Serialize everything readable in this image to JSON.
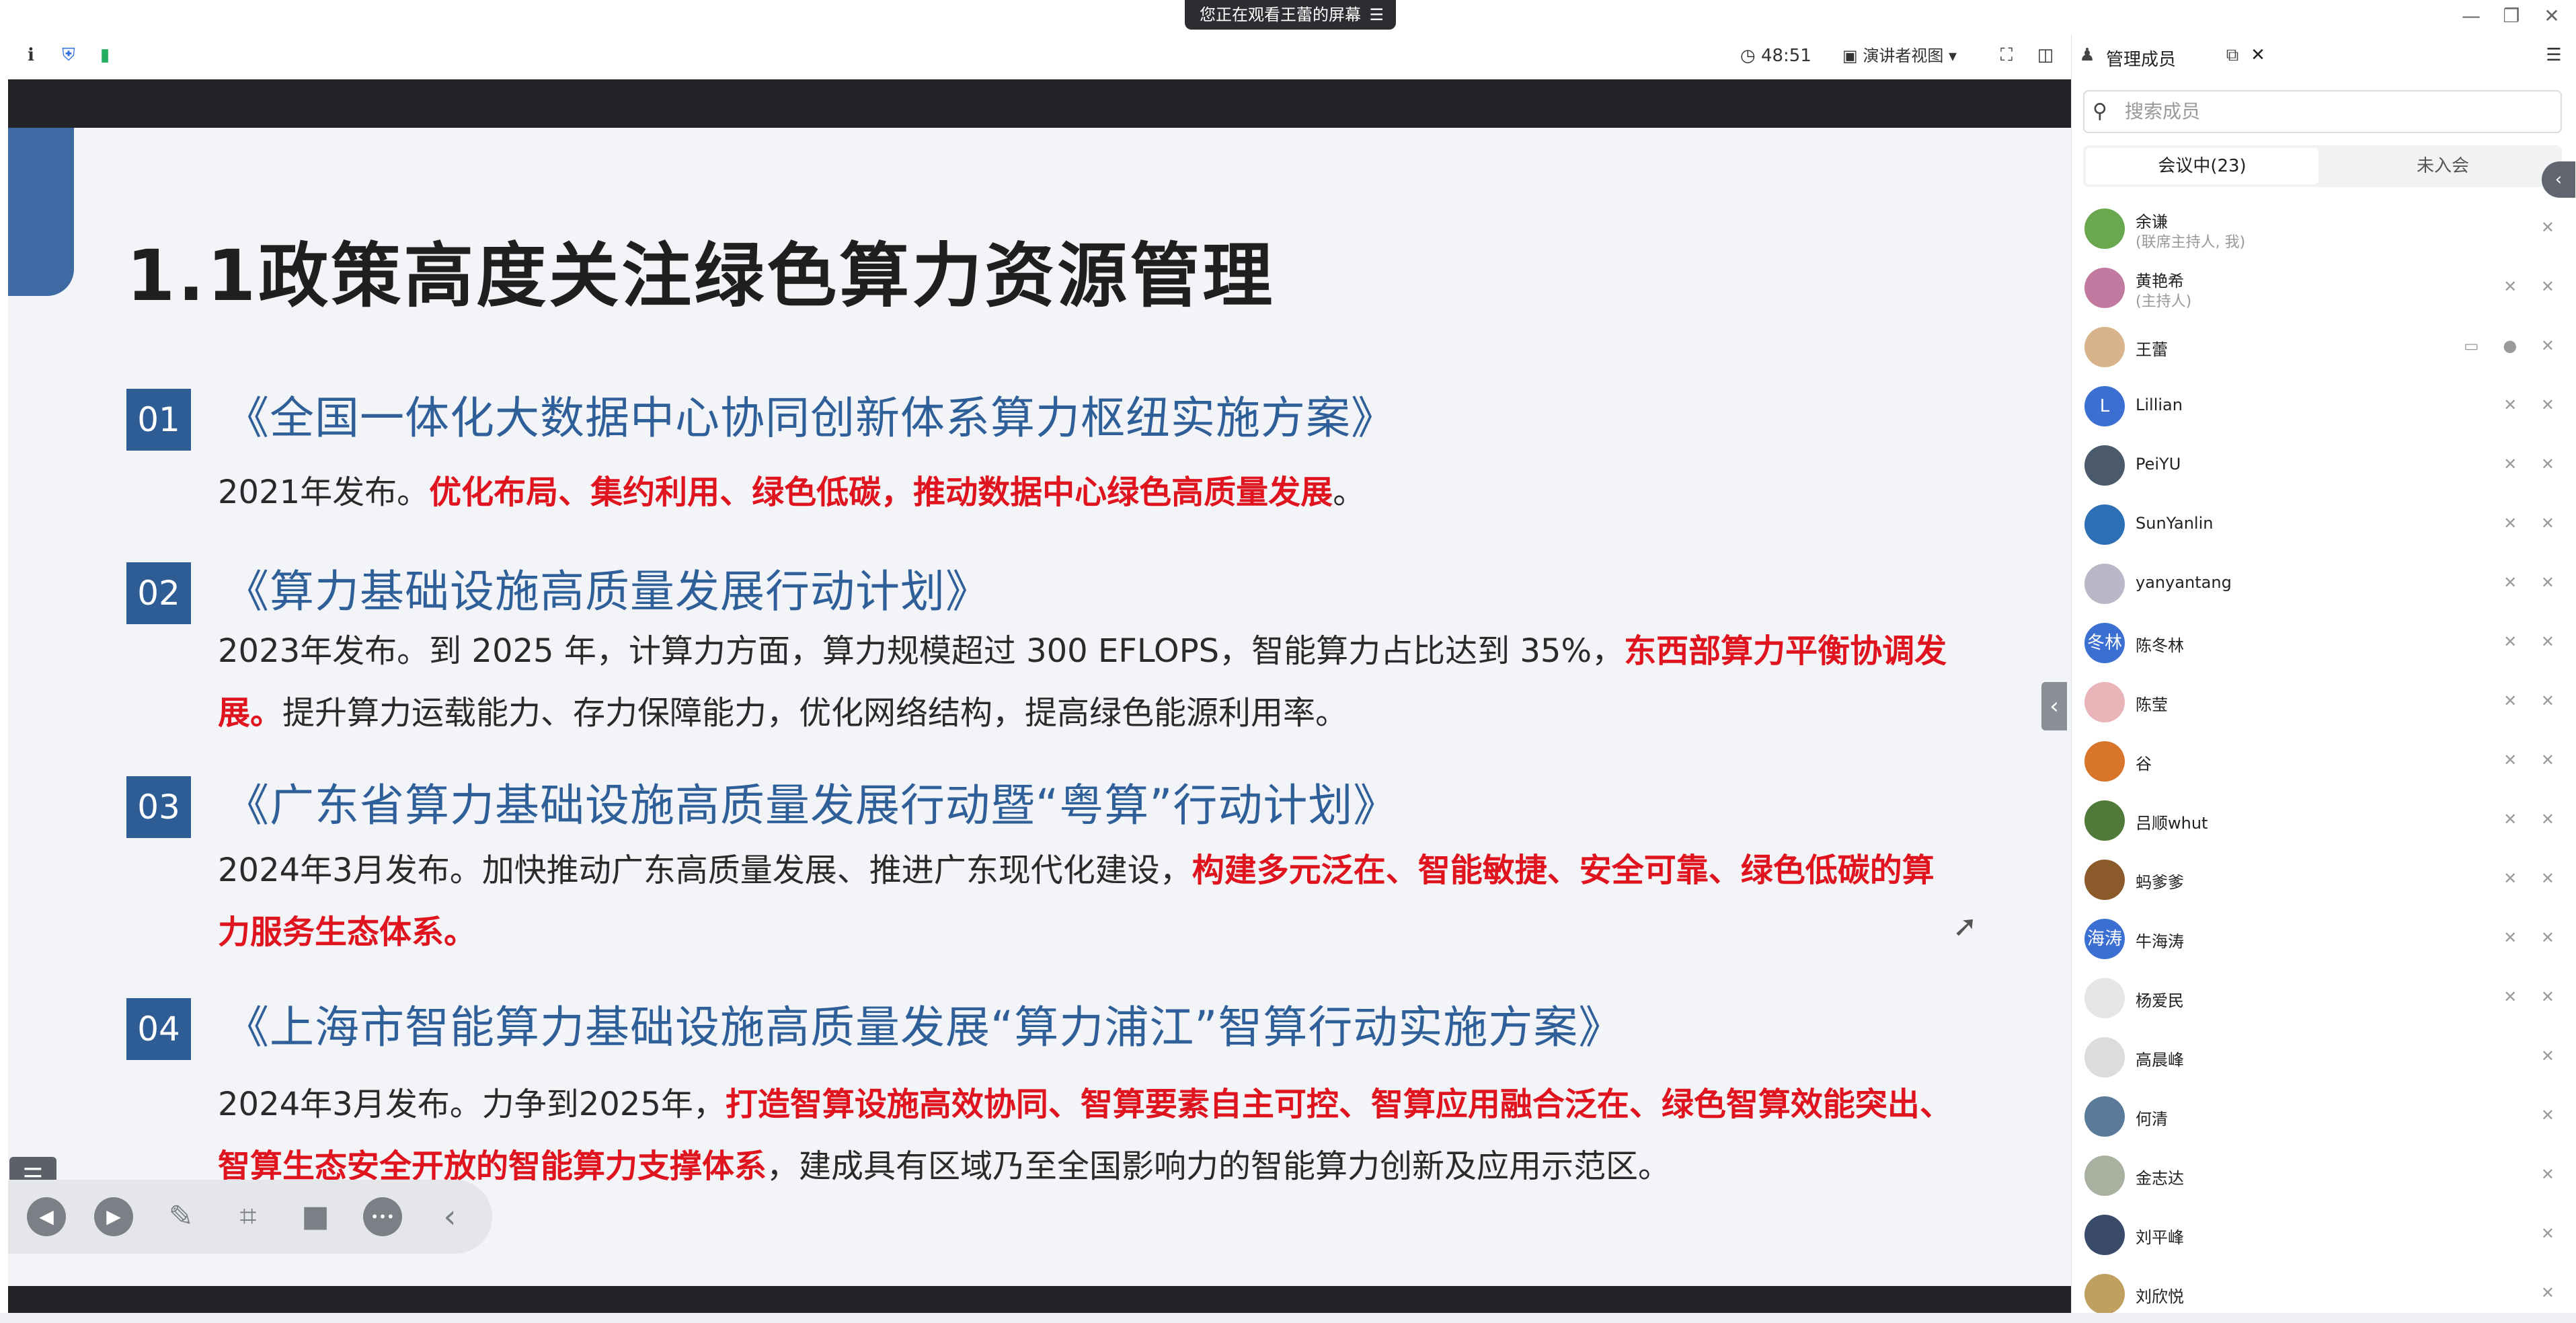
{
  "window": {
    "share_notice": "您正在观看王蕾的屏幕",
    "share_icon": "☰",
    "minimize": "—",
    "restore": "❐",
    "close": "✕"
  },
  "toolbar": {
    "info_icon": "ℹ",
    "shield_icon": "⛨",
    "signal_icon": "▮",
    "timer_icon": "◷",
    "timer": "48:51",
    "view_mode": "演讲者视图",
    "view_icon": "▣",
    "fullscreen_icon": "⛶",
    "layout_icon": "◫"
  },
  "slide": {
    "title": "1.1政策高度关注绿色算力资源管理",
    "items": [
      {
        "num": "01",
        "title": "《全国一体化大数据中心协同创新体系算力枢纽实施方案》",
        "body_plain": "2021年发布。",
        "body_red": "优化布局、集约利用、绿色低碳，推动数据中心绿色高质量发展",
        "body_tail": "。"
      },
      {
        "num": "02",
        "title": "《算力基础设施高质量发展行动计划》",
        "body_plain": "2023年发布。到 2025 年，计算力方面，算力规模超过 300 EFLOPS，智能算力占比达到 35%，",
        "body_red": "东西部算力平衡协调发展。",
        "body_tail": "提升算力运载能力、存力保障能力，优化网络结构，提高绿色能源利用率。"
      },
      {
        "num": "03",
        "title": "《广东省算力基础设施高质量发展行动暨“粤算”行动计划》",
        "body_plain": "2024年3月发布。加快推动广东高质量发展、推进广东现代化建设，",
        "body_red": "构建多元泛在、智能敏捷、安全可靠、绿色低碳的算力服务生态体系。",
        "body_tail": ""
      },
      {
        "num": "04",
        "title": "《上海市智能算力基础设施高质量发展“算力浦江”智算行动实施方案》",
        "body_plain": "2024年3月发布。力争到2025年，",
        "body_red": "打造智算设施高效协同、智算要素自主可控、智算应用融合泛在、绿色智算效能突出、智算生态安全开放的智能算力支撑体系",
        "body_tail": "，建成具有区域乃至全国影响力的智能算力创新及应用示范区。"
      }
    ]
  },
  "controls": {
    "list": "☰",
    "prev": "◀",
    "play": "▶",
    "pen": "✎",
    "screenshot": "⌗",
    "camera": "■",
    "more": "•••",
    "collapse": "‹",
    "side_collapse": "‹"
  },
  "panel": {
    "title": "管理成员",
    "popout_icon": "⧉",
    "close_icon": "✕",
    "menu_icon": "☰",
    "search_placeholder": "搜索成员",
    "search_icon": "⚲",
    "tab_in_meeting": "会议中(23)",
    "tab_not_joined": "未入会",
    "toggle_icon": "‹",
    "members": [
      {
        "name": "余谦",
        "sub": "(联席主持人, 我)",
        "avatar_text": "",
        "avatar_color": "#6aa84f",
        "icons": "✕"
      },
      {
        "name": "黄艳希",
        "sub": "(主持人)",
        "avatar_text": "",
        "avatar_color": "#c27ba0",
        "icons": "✕ ✕"
      },
      {
        "name": "王蕾",
        "sub": "",
        "avatar_text": "",
        "avatar_color": "#d9b38c",
        "icons": "▭ ● ✕"
      },
      {
        "name": "Lillian",
        "sub": "",
        "avatar_text": "L",
        "avatar_color": "#3b6fd1",
        "icons": "✕ ✕"
      },
      {
        "name": "PeiYU",
        "sub": "",
        "avatar_text": "",
        "avatar_color": "#4a5a6a",
        "icons": "✕ ✕"
      },
      {
        "name": "SunYanlin",
        "sub": "",
        "avatar_text": "",
        "avatar_color": "#2d6fb5",
        "icons": "✕ ✕"
      },
      {
        "name": "yanyantang",
        "sub": "",
        "avatar_text": "",
        "avatar_color": "#b8b8c8",
        "icons": "✕ ✕"
      },
      {
        "name": "陈冬林",
        "sub": "",
        "avatar_text": "冬林",
        "avatar_color": "#3b6fd1",
        "icons": "✕ ✕"
      },
      {
        "name": "陈莹",
        "sub": "",
        "avatar_text": "",
        "avatar_color": "#e8b4b8",
        "icons": "✕ ✕"
      },
      {
        "name": "谷",
        "sub": "",
        "avatar_text": "",
        "avatar_color": "#d9742b",
        "icons": "✕ ✕"
      },
      {
        "name": "吕顺whut",
        "sub": "",
        "avatar_text": "",
        "avatar_color": "#4f7a3a",
        "icons": "✕ ✕"
      },
      {
        "name": "蚂爹爹",
        "sub": "",
        "avatar_text": "",
        "avatar_color": "#8a5a2b",
        "icons": "✕ ✕"
      },
      {
        "name": "牛海涛",
        "sub": "",
        "avatar_text": "海涛",
        "avatar_color": "#3b6fd1",
        "icons": "✕ ✕"
      },
      {
        "name": "杨爱民",
        "sub": "",
        "avatar_text": "",
        "avatar_color": "#e6e6e6",
        "icons": "✕ ✕"
      },
      {
        "name": "高晨峰",
        "sub": "",
        "avatar_text": "",
        "avatar_color": "#dcdcdc",
        "icons": "✕"
      },
      {
        "name": "何清",
        "sub": "",
        "avatar_text": "",
        "avatar_color": "#5a7a9a",
        "icons": "✕"
      },
      {
        "name": "金志达",
        "sub": "",
        "avatar_text": "",
        "avatar_color": "#a8b0a0",
        "icons": "✕"
      },
      {
        "name": "刘平峰",
        "sub": "",
        "avatar_text": "",
        "avatar_color": "#3a4a6a",
        "icons": "✕"
      },
      {
        "name": "刘欣悦",
        "sub": "",
        "avatar_text": "",
        "avatar_color": "#c0a060",
        "icons": "✕"
      }
    ]
  }
}
